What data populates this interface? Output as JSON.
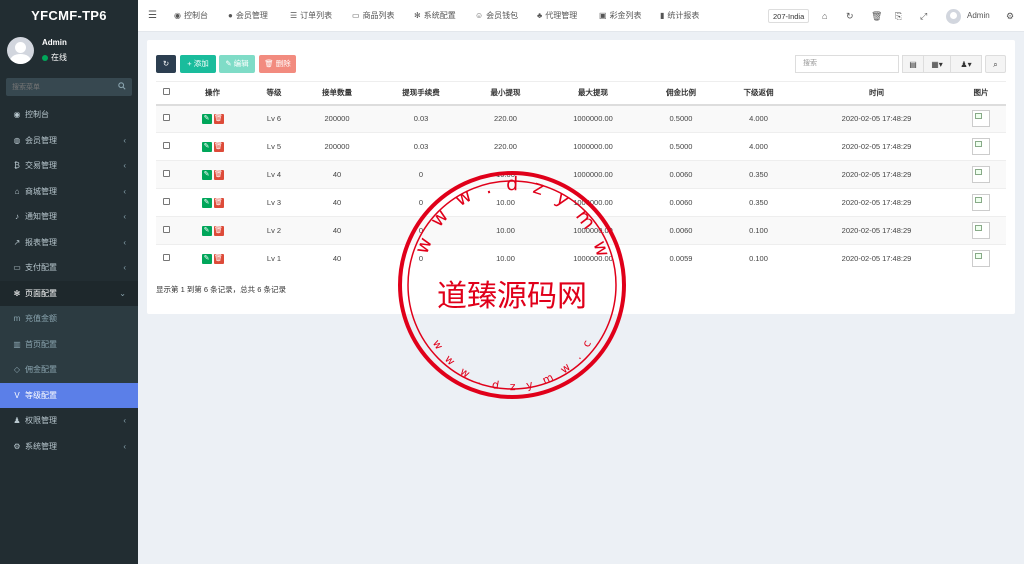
{
  "app": {
    "brand": "YFCMF-TP6"
  },
  "user": {
    "name": "Admin",
    "status": "在线"
  },
  "sidebar": {
    "search_placeholder": "搜索菜单",
    "items": [
      {
        "label": "控制台",
        "icon": "dashboard-icon",
        "glyph": "◉",
        "chevron": false
      },
      {
        "label": "会员管理",
        "icon": "user-circle-icon",
        "glyph": "◍",
        "chevron": true
      },
      {
        "label": "交易管理",
        "icon": "bitcoin-icon",
        "glyph": "₿",
        "chevron": true
      },
      {
        "label": "商城管理",
        "icon": "home-icon",
        "glyph": "⌂",
        "chevron": true
      },
      {
        "label": "通知管理",
        "icon": "bell-icon",
        "glyph": "♪",
        "chevron": true
      },
      {
        "label": "报表管理",
        "icon": "line-chart-icon",
        "glyph": "↗",
        "chevron": true
      },
      {
        "label": "支付配置",
        "icon": "credit-card-icon",
        "glyph": "▭",
        "chevron": true
      },
      {
        "label": "页面配置",
        "icon": "gear-icon",
        "glyph": "✻",
        "chevron": "open"
      },
      {
        "label": "充值金额",
        "icon": "m-icon",
        "glyph": "m",
        "sub": true
      },
      {
        "label": "首页配置",
        "icon": "columns-icon",
        "glyph": "▥",
        "sub": true
      },
      {
        "label": "佣金配置",
        "icon": "diamond-icon",
        "glyph": "◇",
        "sub": true
      },
      {
        "label": "等级配置",
        "icon": "vimeo-icon",
        "glyph": "V",
        "sub": true,
        "active": true
      },
      {
        "label": "权限管理",
        "icon": "users-icon",
        "glyph": "♟",
        "chevron": true
      },
      {
        "label": "系统管理",
        "icon": "gears-icon",
        "glyph": "⚙",
        "chevron": true
      }
    ]
  },
  "topbar": {
    "menu_icon": "hamburger-icon",
    "nav": [
      {
        "label": "控制台",
        "glyph": "◉",
        "icon": "dashboard-icon"
      },
      {
        "label": "会员管理",
        "glyph": "●",
        "icon": "user-icon"
      },
      {
        "label": "订单列表",
        "glyph": "☰",
        "icon": "list-icon"
      },
      {
        "label": "商品列表",
        "glyph": "▭",
        "icon": "desktop-icon"
      },
      {
        "label": "系统配置",
        "glyph": "✻",
        "icon": "gear-icon"
      },
      {
        "label": "会员钱包",
        "glyph": "☺",
        "icon": "wallet-icon"
      },
      {
        "label": "代理管理",
        "glyph": "♣",
        "icon": "sitemap-icon"
      },
      {
        "label": "彩金列表",
        "glyph": "▣",
        "icon": "gift-icon"
      },
      {
        "label": "统计报表",
        "glyph": "▮",
        "icon": "bar-chart-icon"
      }
    ],
    "lang": "207-India",
    "admin_name": "Admin"
  },
  "toolbar": {
    "refresh_label": "↻",
    "add_label": "+ 添加",
    "edit_label": "✎ 编辑",
    "delete_label": "🗑 删除",
    "search_placeholder": "搜索",
    "colors": {
      "add": "#1abc9c",
      "edit": "#7fdcc7",
      "delete": "#f28b7f",
      "refresh": "#2c3e50"
    }
  },
  "table": {
    "headers": [
      "",
      "操作",
      "等级",
      "接单数量",
      "提现手续费",
      "最小提现",
      "最大提现",
      "佣金比例",
      "下级返佣",
      "时间",
      "图片"
    ],
    "rows": [
      {
        "level": "Lv 6",
        "orders": "200000",
        "fee": "0.03",
        "min": "220.00",
        "max": "1000000.00",
        "ratio": "0.5000",
        "rebate": "4.000",
        "time": "2020-02-05 17:48:29"
      },
      {
        "level": "Lv 5",
        "orders": "200000",
        "fee": "0.03",
        "min": "220.00",
        "max": "1000000.00",
        "ratio": "0.5000",
        "rebate": "4.000",
        "time": "2020-02-05 17:48:29"
      },
      {
        "level": "Lv 4",
        "orders": "40",
        "fee": "0",
        "min": "10.00",
        "max": "1000000.00",
        "ratio": "0.0060",
        "rebate": "0.350",
        "time": "2020-02-05 17:48:29"
      },
      {
        "level": "Lv 3",
        "orders": "40",
        "fee": "0",
        "min": "10.00",
        "max": "1000000.00",
        "ratio": "0.0060",
        "rebate": "0.350",
        "time": "2020-02-05 17:48:29"
      },
      {
        "level": "Lv 2",
        "orders": "40",
        "fee": "0",
        "min": "10.00",
        "max": "1000000.00",
        "ratio": "0.0060",
        "rebate": "0.100",
        "time": "2020-02-05 17:48:29"
      },
      {
        "level": "Lv 1",
        "orders": "40",
        "fee": "0",
        "min": "10.00",
        "max": "1000000.00",
        "ratio": "0.0059",
        "rebate": "0.100",
        "time": "2020-02-05 17:48:29"
      }
    ],
    "footer": "显示第 1 到第 6 条记录，总共 6 条记录"
  },
  "watermark": {
    "title": "道臻源码网",
    "url": "w w w . d z y m w . c o m",
    "color": "#e0001a"
  }
}
